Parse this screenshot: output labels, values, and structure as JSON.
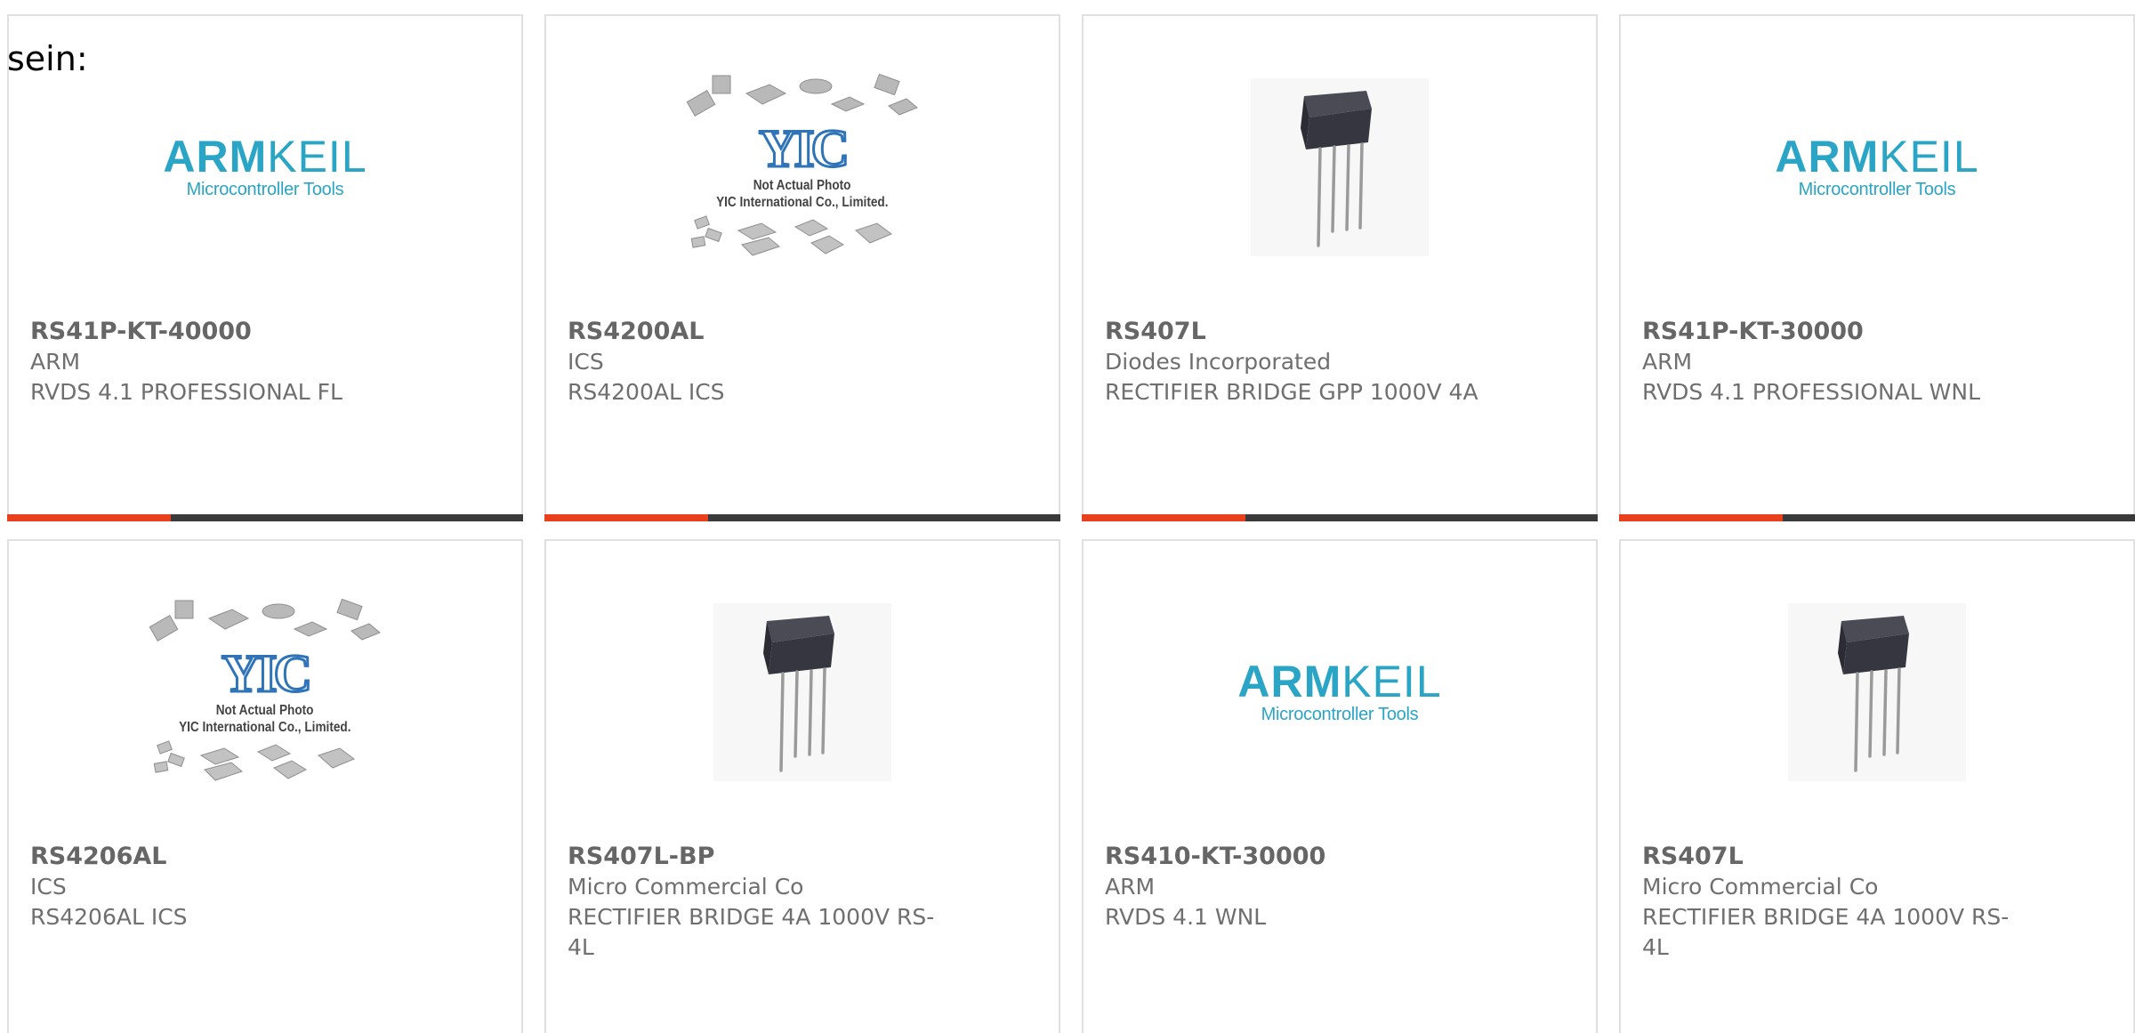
{
  "intro_text": "sein:",
  "colors": {
    "accent": "#e8401c",
    "bar": "#3a3a3a",
    "card_border": "#e0e0e0",
    "text": "#6f6f6f",
    "logo_teal": "#2aa5c6",
    "yic_blue": "#2f74b8"
  },
  "logos": {
    "armkeil": {
      "word_arm": "ARM",
      "word_keil": "KEIL",
      "tagline": "Microcontroller Tools"
    },
    "yic": {
      "mark": "YIC",
      "line1": "Not Actual Photo",
      "line2": "YIC International Co., Limited."
    }
  },
  "products": [
    {
      "part_number": "RS41P-KT-40000",
      "manufacturer": "ARM",
      "description": "RVDS 4.1 PROFESSIONAL FL",
      "image": "armkeil-logo",
      "has_bar": true
    },
    {
      "part_number": "RS4200AL",
      "manufacturer": "ICS",
      "description": "RS4200AL ICS",
      "image": "yic-placeholder",
      "has_bar": true
    },
    {
      "part_number": "RS407L",
      "manufacturer": "Diodes Incorporated",
      "description": "RECTIFIER BRIDGE GPP 1000V 4A",
      "image": "bridge-rectifier-photo",
      "has_bar": true
    },
    {
      "part_number": "RS41P-KT-30000",
      "manufacturer": "ARM",
      "description": "RVDS 4.1 PROFESSIONAL WNL",
      "image": "armkeil-logo",
      "has_bar": true
    },
    {
      "part_number": "RS4206AL",
      "manufacturer": "ICS",
      "description": "RS4206AL ICS",
      "image": "yic-placeholder",
      "has_bar": false
    },
    {
      "part_number": "RS407L-BP",
      "manufacturer": "Micro Commercial Co",
      "description": "RECTIFIER BRIDGE 4A 1000V RS-4L",
      "image": "bridge-rectifier-photo",
      "has_bar": false
    },
    {
      "part_number": "RS410-KT-30000",
      "manufacturer": "ARM",
      "description": "RVDS 4.1 WNL",
      "image": "armkeil-logo",
      "has_bar": false
    },
    {
      "part_number": "RS407L",
      "manufacturer": "Micro Commercial Co",
      "description": "RECTIFIER BRIDGE 4A 1000V RS-4L",
      "image": "bridge-rectifier-photo",
      "has_bar": false
    }
  ]
}
